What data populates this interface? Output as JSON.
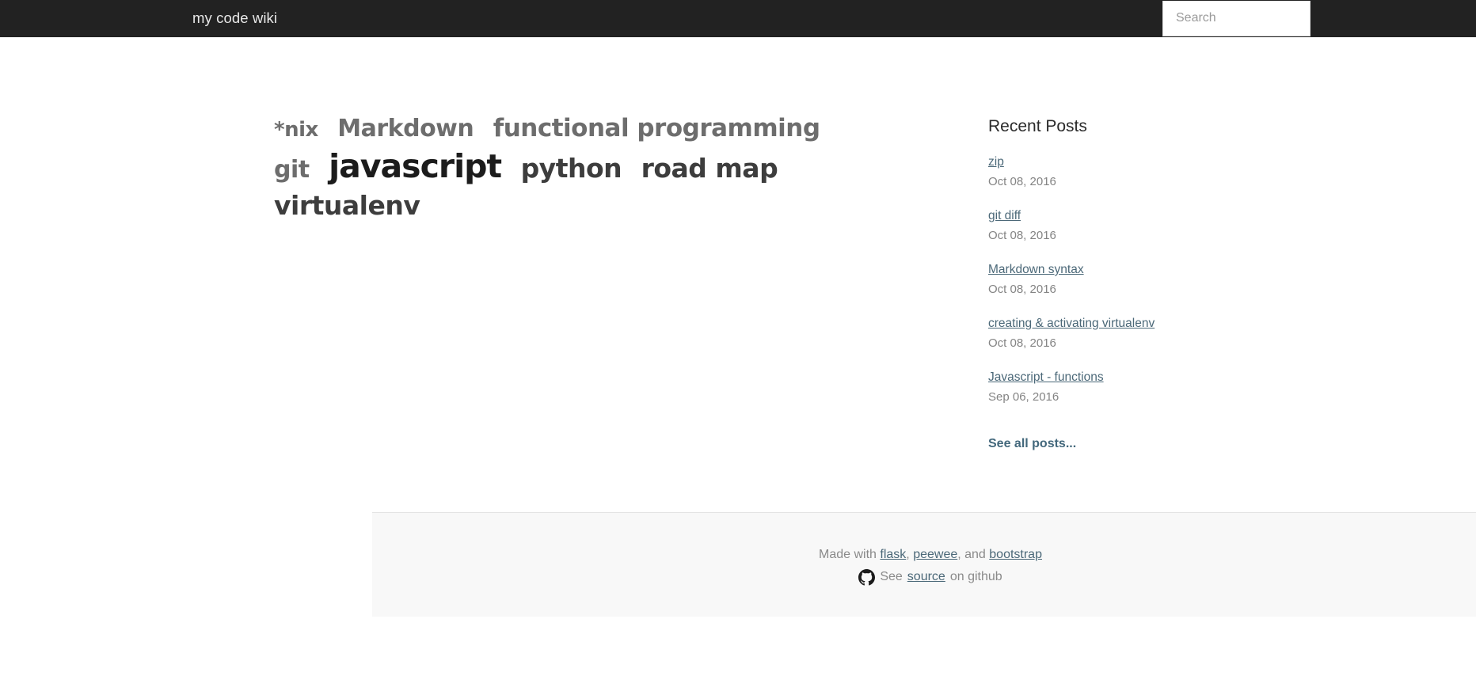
{
  "navbar": {
    "brand": "my code wiki",
    "search_placeholder": "Search",
    "search_value": "",
    "background_color": "#222222"
  },
  "tag_cloud": {
    "rows": [
      [
        {
          "label": "*nix",
          "size_class": "s1"
        },
        {
          "label": "Markdown",
          "size_class": "s2"
        },
        {
          "label": "functional programming",
          "size_class": "s3"
        }
      ],
      [
        {
          "label": "git",
          "size_class": "s2"
        },
        {
          "label": "javascript",
          "size_class": "s5"
        },
        {
          "label": "python",
          "size_class": "s4"
        },
        {
          "label": "road map",
          "size_class": "s4"
        }
      ],
      [
        {
          "label": "virtualenv",
          "size_class": "s4"
        }
      ]
    ],
    "tags": {
      "nix": "*nix",
      "markdown": "Markdown",
      "functional_programming": "functional programming",
      "git": "git",
      "javascript": "javascript",
      "python": "python",
      "road_map": "road map",
      "virtualenv": "virtualenv"
    },
    "color_default": "#6d6d6d",
    "color_emphasis": "#1c1c1c"
  },
  "sidebar": {
    "title": "Recent Posts",
    "posts": [
      {
        "title": "zip",
        "date": "Oct 08, 2016"
      },
      {
        "title": "git diff",
        "date": "Oct 08, 2016"
      },
      {
        "title": "Markdown syntax",
        "date": "Oct 08, 2016"
      },
      {
        "title": "creating & activating virtualenv",
        "date": "Oct 08, 2016"
      },
      {
        "title": "Javascript - functions",
        "date": "Sep 06, 2016"
      }
    ],
    "see_all_label": "See all posts...",
    "link_color": "#4b6878",
    "date_color": "#848484"
  },
  "footer": {
    "made_with_prefix": "Made with ",
    "flask": "flask",
    "sep1": ", ",
    "peewee": "peewee",
    "sep2": ", and ",
    "bootstrap": "bootstrap",
    "see_prefix": "See ",
    "source": "source",
    "see_suffix": " on github",
    "github_icon": "github-octocat-icon",
    "background_color": "#f8f8f8"
  }
}
